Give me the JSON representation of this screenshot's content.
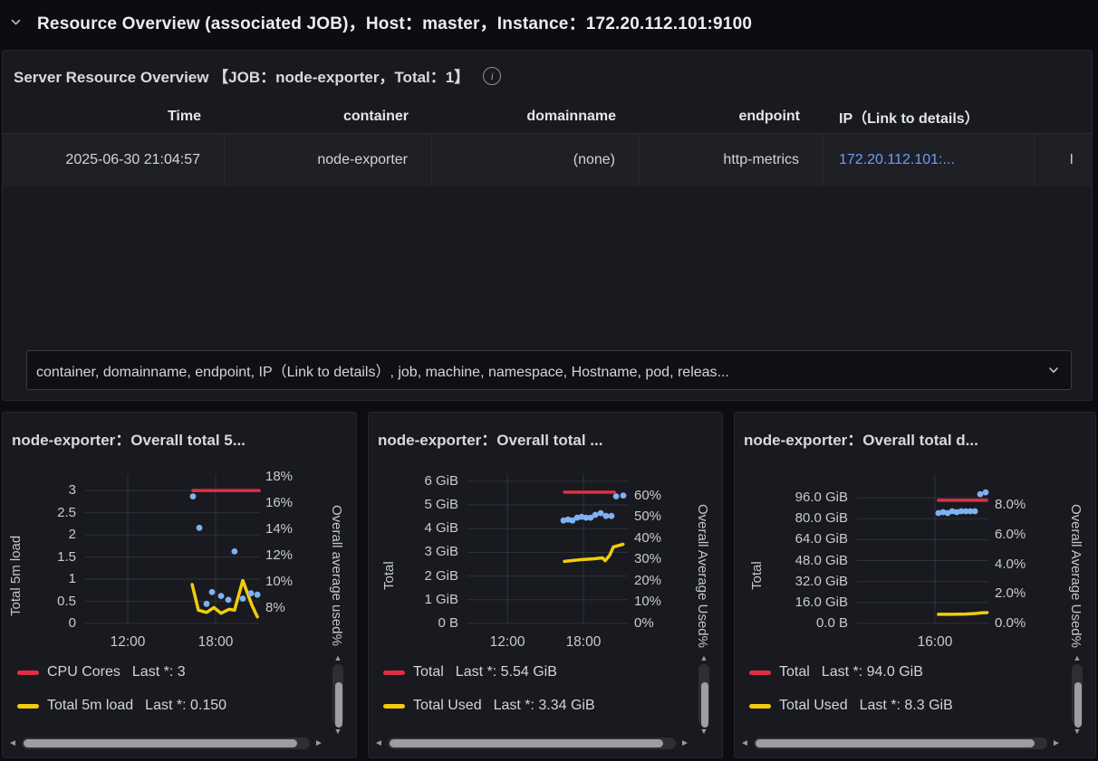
{
  "row_header": {
    "title": "Resource Overview (associated JOB)，Host：master，Instance：172.20.112.101:9100"
  },
  "table_panel": {
    "title": "Server Resource Overview 【JOB：node-exporter，Total：1】",
    "info_icon": "i",
    "columns": [
      "Time",
      "container",
      "domainname",
      "endpoint",
      "IP（Link to details）",
      ""
    ],
    "rows": [
      {
        "time": "2025-06-30 21:04:57",
        "container": "node-exporter",
        "domainname": "(none)",
        "endpoint": "http-metrics",
        "ip_link": "172.20.112.101:...",
        "extra": "I"
      }
    ],
    "fields_select": {
      "value": "container, domainname, endpoint, IP（Link to details）, job, machine, namespace, Hostname, pod, releas..."
    }
  },
  "colors": {
    "red": "#e02f44",
    "yellow": "#f2cc0c",
    "blue": "#7eb2f2",
    "link": "#6c9cf7"
  },
  "chart_data": [
    {
      "type": "line",
      "title": "node-exporter：Overall total 5...",
      "x_axis": {
        "ticks": [
          {
            "label": "12:00",
            "frac": 0.245
          },
          {
            "label": "18:00",
            "frac": 0.75
          }
        ]
      },
      "left_axis": {
        "label": "Total 5m load",
        "range": [
          0,
          3.37
        ],
        "ticks": [
          {
            "label": "3",
            "value": 3
          },
          {
            "label": "2.5",
            "value": 2.5
          },
          {
            "label": "2",
            "value": 2
          },
          {
            "label": "1.5",
            "value": 1.5
          },
          {
            "label": "1",
            "value": 1
          },
          {
            "label": "0.5",
            "value": 0.5
          },
          {
            "label": "0",
            "value": 0
          }
        ]
      },
      "right_axis": {
        "label": "Overall average used%",
        "range": [
          6.8,
          18.2
        ],
        "ticks": [
          {
            "label": "18%",
            "value": 18
          },
          {
            "label": "16%",
            "value": 16
          },
          {
            "label": "14%",
            "value": 14
          },
          {
            "label": "12%",
            "value": 12
          },
          {
            "label": "10%",
            "value": 10
          },
          {
            "label": "8%",
            "value": 8
          }
        ]
      },
      "series": [
        {
          "name": "CPU Cores",
          "axis": "left",
          "style": "line",
          "color": "#e02f44",
          "points": [
            [
              0.62,
              3
            ],
            [
              1.0,
              3
            ]
          ]
        },
        {
          "name": "Total 5m load",
          "axis": "left",
          "style": "line",
          "color": "#f2cc0c",
          "points": [
            [
              0.615,
              0.88
            ],
            [
              0.651,
              0.3
            ],
            [
              0.698,
              0.25
            ],
            [
              0.74,
              0.36
            ],
            [
              0.781,
              0.23
            ],
            [
              0.828,
              0.32
            ],
            [
              0.859,
              0.3
            ],
            [
              0.906,
              0.97
            ],
            [
              0.958,
              0.42
            ],
            [
              0.99,
              0.15
            ]
          ]
        },
        {
          "name": "unlabeled-dots",
          "axis": "right",
          "style": "points",
          "color": "#7eb2f2",
          "points": [
            [
              0.62,
              16.5
            ],
            [
              0.656,
              14.1
            ],
            [
              0.698,
              8.3
            ],
            [
              0.729,
              9.2
            ],
            [
              0.781,
              8.9
            ],
            [
              0.823,
              8.6
            ],
            [
              0.859,
              12.3
            ],
            [
              0.906,
              8.7
            ],
            [
              0.953,
              9.1
            ],
            [
              0.99,
              9.0
            ]
          ]
        }
      ],
      "legend": [
        {
          "name": "CPU Cores",
          "value": "Last *: 3",
          "color": "#e02f44"
        },
        {
          "name": "Total 5m load",
          "value": "Last *: 0.150",
          "color": "#f2cc0c"
        }
      ]
    },
    {
      "type": "line",
      "title": "node-exporter：Overall total ...",
      "x_axis": {
        "ticks": [
          {
            "label": "12:00",
            "frac": 0.249
          },
          {
            "label": "18:00",
            "frac": 0.723
          }
        ]
      },
      "left_axis": {
        "label": "Total",
        "range": [
          0,
          6.3
        ],
        "ticks": [
          {
            "label": "6 GiB",
            "value": 6
          },
          {
            "label": "5 GiB",
            "value": 5
          },
          {
            "label": "4 GiB",
            "value": 4
          },
          {
            "label": "3 GiB",
            "value": 3
          },
          {
            "label": "2 GiB",
            "value": 2
          },
          {
            "label": "1 GiB",
            "value": 1
          },
          {
            "label": "0 B",
            "value": 0
          }
        ]
      },
      "right_axis": {
        "label": "Overall Average Used%",
        "range": [
          0,
          70
        ],
        "ticks": [
          {
            "label": "60%",
            "value": 60
          },
          {
            "label": "50%",
            "value": 50
          },
          {
            "label": "40%",
            "value": 40
          },
          {
            "label": "30%",
            "value": 30
          },
          {
            "label": "20%",
            "value": 20
          },
          {
            "label": "10%",
            "value": 10
          },
          {
            "label": "0%",
            "value": 0
          }
        ]
      },
      "series": [
        {
          "name": "Total",
          "axis": "left",
          "style": "line",
          "color": "#e02f44",
          "points": [
            [
              0.605,
              5.54
            ],
            [
              0.916,
              5.54
            ]
          ]
        },
        {
          "name": "Total Used",
          "axis": "left",
          "style": "line",
          "color": "#f2cc0c",
          "points": [
            [
              0.605,
              2.62
            ],
            [
              0.706,
              2.69
            ],
            [
              0.791,
              2.73
            ],
            [
              0.842,
              2.77
            ],
            [
              0.859,
              2.65
            ],
            [
              0.887,
              2.88
            ],
            [
              0.91,
              3.23
            ],
            [
              0.97,
              3.34
            ]
          ]
        },
        {
          "name": "unlabeled-dots",
          "axis": "right",
          "style": "points",
          "color": "#7eb2f2",
          "points": [
            [
              0.599,
              48.3
            ],
            [
              0.627,
              48.7
            ],
            [
              0.655,
              48.3
            ],
            [
              0.684,
              49.6
            ],
            [
              0.712,
              50
            ],
            [
              0.74,
              49.6
            ],
            [
              0.768,
              49.6
            ],
            [
              0.797,
              50.9
            ],
            [
              0.831,
              51.7
            ],
            [
              0.864,
              50.4
            ],
            [
              0.898,
              50.4
            ],
            [
              0.927,
              59.6
            ],
            [
              0.972,
              60
            ]
          ]
        }
      ],
      "legend": [
        {
          "name": "Total",
          "value": "Last *: 5.54 GiB",
          "color": "#e02f44"
        },
        {
          "name": "Total Used",
          "value": "Last *: 3.34 GiB",
          "color": "#f2cc0c"
        }
      ]
    },
    {
      "type": "line",
      "title": "node-exporter：Overall total d...",
      "x_axis": {
        "ticks": [
          {
            "label": "16:00",
            "frac": 0.593
          }
        ]
      },
      "left_axis": {
        "label": "Total",
        "range": [
          0,
          114
        ],
        "ticks": [
          {
            "label": "96.0 GiB",
            "value": 96
          },
          {
            "label": "80.0 GiB",
            "value": 80
          },
          {
            "label": "64.0 GiB",
            "value": 64
          },
          {
            "label": "48.0 GiB",
            "value": 48
          },
          {
            "label": "32.0 GiB",
            "value": 32
          },
          {
            "label": "16.0 GiB",
            "value": 16
          },
          {
            "label": "0.0 B",
            "value": 0
          }
        ]
      },
      "right_axis": {
        "label": "Overall Average Used%",
        "range": [
          0,
          10.1
        ],
        "ticks": [
          {
            "label": "8.0%",
            "value": 8
          },
          {
            "label": "6.0%",
            "value": 6
          },
          {
            "label": "4.0%",
            "value": 4
          },
          {
            "label": "2.0%",
            "value": 2
          },
          {
            "label": "0.0%",
            "value": 0
          }
        ]
      },
      "series": [
        {
          "name": "Total",
          "axis": "left",
          "style": "line",
          "color": "#e02f44",
          "points": [
            [
              0.62,
              94
            ],
            [
              0.986,
              94
            ]
          ]
        },
        {
          "name": "Total Used",
          "axis": "left",
          "style": "line",
          "color": "#f2cc0c",
          "points": [
            [
              0.62,
              7.0
            ],
            [
              0.72,
              7.0
            ],
            [
              0.83,
              7.2
            ],
            [
              0.9,
              7.6
            ],
            [
              0.95,
              8.1
            ],
            [
              0.99,
              8.3
            ]
          ]
        },
        {
          "name": "unlabeled-dots",
          "axis": "right",
          "style": "points",
          "color": "#7eb2f2",
          "points": [
            [
              0.62,
              7.47
            ],
            [
              0.655,
              7.53
            ],
            [
              0.69,
              7.47
            ],
            [
              0.724,
              7.59
            ],
            [
              0.759,
              7.53
            ],
            [
              0.793,
              7.59
            ],
            [
              0.828,
              7.59
            ],
            [
              0.862,
              7.59
            ],
            [
              0.897,
              7.59
            ],
            [
              0.938,
              8.75
            ],
            [
              0.979,
              8.87
            ]
          ]
        }
      ],
      "legend": [
        {
          "name": "Total",
          "value": "Last *: 94.0 GiB",
          "color": "#e02f44"
        },
        {
          "name": "Total Used",
          "value": "Last *: 8.3 GiB",
          "color": "#f2cc0c"
        }
      ]
    }
  ]
}
